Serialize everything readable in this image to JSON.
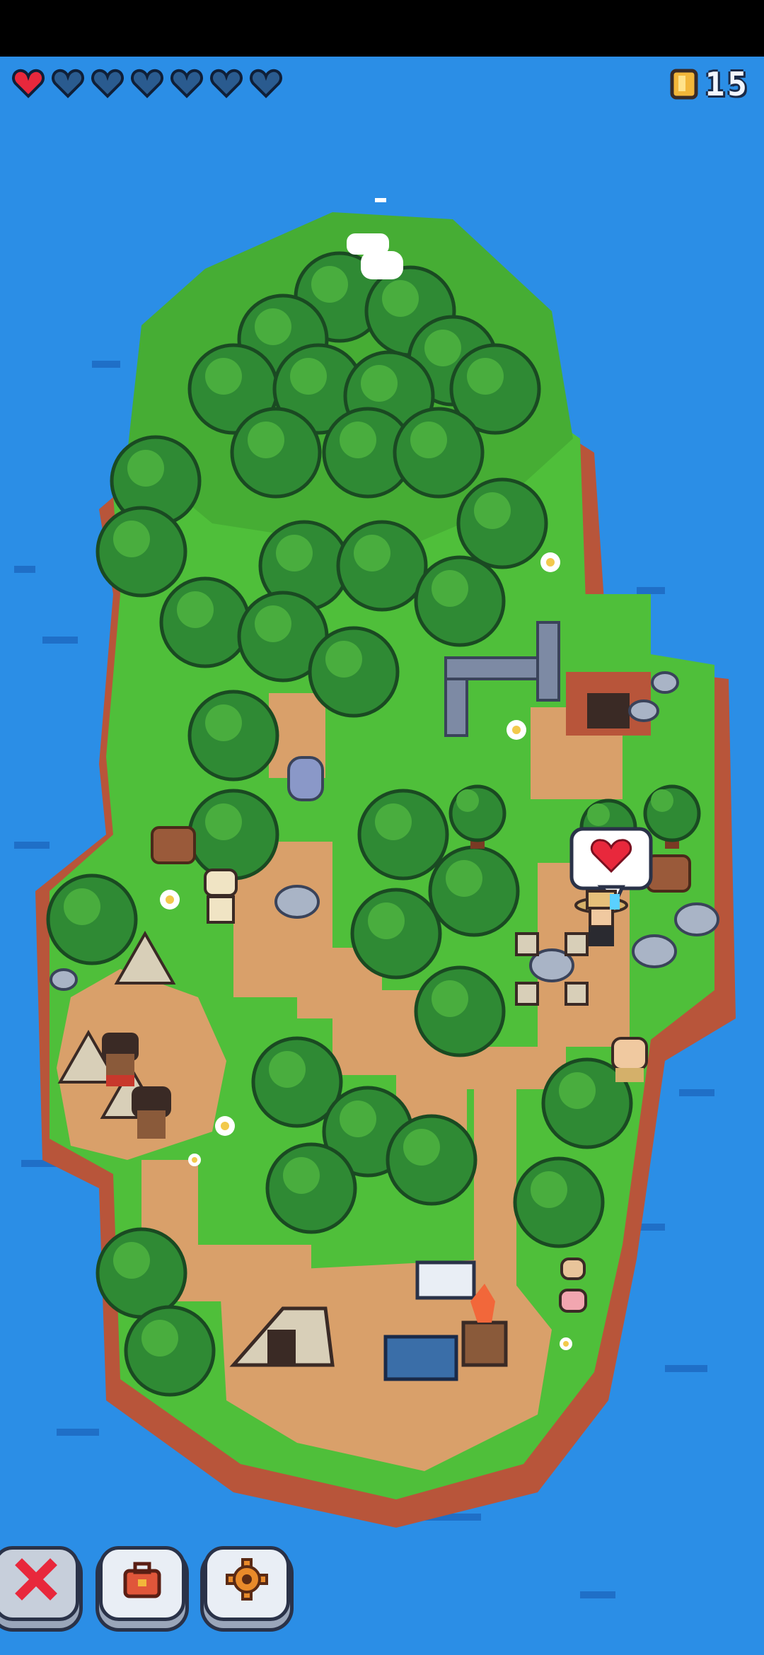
{
  "hud": {
    "hearts_total": 7,
    "hearts_filled": 1,
    "coin_icon": "coin-icon",
    "coin_count": "15"
  },
  "buttons": [
    {
      "name": "close-button",
      "icon": "close-icon"
    },
    {
      "name": "inventory-button",
      "icon": "backpack-icon"
    },
    {
      "name": "settings-button",
      "icon": "gear-icon"
    }
  ],
  "speech_bubble": {
    "icon": "heart-icon"
  },
  "colors": {
    "ocean": "#2b8ee6",
    "grass": "#4fbf3a",
    "path": "#d9a06a",
    "heart_full": "#e8283c",
    "heart_empty": "#2a5b8f"
  }
}
